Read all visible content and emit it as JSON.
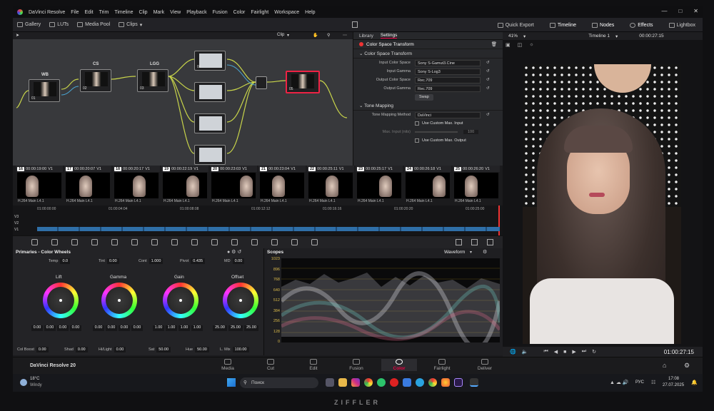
{
  "menubar": {
    "app": "DaVinci Resolve",
    "items": [
      "File",
      "Edit",
      "Trim",
      "Timeline",
      "Clip",
      "Mark",
      "View",
      "Playback",
      "Fusion",
      "Color",
      "Fairlight",
      "Workspace",
      "Help"
    ]
  },
  "toolbar": {
    "gallery": "Gallery",
    "luts": "LUTs",
    "media_pool": "Media Pool",
    "clips": "Clips",
    "quick_export": "Quick Export",
    "timeline": "Timeline",
    "nodes": "Nodes",
    "effects": "Effects",
    "lightbox": "Lightbox"
  },
  "nodebar": {
    "clip": "Clip"
  },
  "nodes": {
    "n1": {
      "label": "WB",
      "num": "01"
    },
    "n2": {
      "label": "CS",
      "num": "02"
    },
    "n3": {
      "label": "LGG",
      "num": "03"
    },
    "n4": {
      "num": "04"
    },
    "n5": {
      "num": "05"
    }
  },
  "panel": {
    "tab_library": "Library",
    "tab_settings": "Settings",
    "title": "Color Space Transform",
    "section1": "Color Space Transform",
    "input_cs_label": "Input Color Space",
    "input_cs": "Sony S-Gamut3.Cine",
    "input_gamma_label": "Input Gamma",
    "input_gamma": "Sony S-Log3",
    "output_cs_label": "Output Color Space",
    "output_cs": "Rec.709",
    "output_gamma_label": "Output Gamma",
    "output_gamma": "Rec.709",
    "swap": "Swap",
    "section2": "Tone Mapping",
    "tm_method_label": "Tone Mapping Method",
    "tm_method": "DaVinci",
    "custom_input": "Use Custom Max. Input",
    "max_input_label": "Max. Input (nits)",
    "max_input": "100",
    "custom_output": "Use Custom Max. Output"
  },
  "viewer": {
    "zoom": "41%",
    "timeline_name": "Timeline 1",
    "timecode_top": "00:00:27:15",
    "timecode": "01:00:27:15"
  },
  "clips": [
    {
      "n": "16",
      "tc": "00:00:19:00",
      "v": "V1",
      "codec": "H.264 Main L4.1"
    },
    {
      "n": "17",
      "tc": "00:00:20:07",
      "v": "V1",
      "codec": "H.264 Main L4.1"
    },
    {
      "n": "18",
      "tc": "00:00:20:17",
      "v": "V1",
      "codec": "H.264 Main L4.1"
    },
    {
      "n": "19",
      "tc": "00:00:22:19",
      "v": "V1",
      "codec": "H.264 Main L4.1"
    },
    {
      "n": "20",
      "tc": "00:00:23:03",
      "v": "V1",
      "codec": "H.264 Main L4.1"
    },
    {
      "n": "21",
      "tc": "00:00:23:04",
      "v": "V1",
      "codec": "H.264 Main L4.1"
    },
    {
      "n": "22",
      "tc": "00:00:25:11",
      "v": "V1",
      "codec": "H.264 Main L4.1"
    },
    {
      "n": "23",
      "tc": "00:00:25:17",
      "v": "V1",
      "codec": "H.264 Main L4.1"
    },
    {
      "n": "24",
      "tc": "00:00:26:18",
      "v": "V1",
      "codec": "H.264 Main L4.1"
    },
    {
      "n": "25",
      "tc": "00:00:26:20",
      "v": "V1",
      "codec": "H.264 Main L4.1"
    }
  ],
  "ruler": [
    "01:00:00:00",
    "01:00:04:04",
    "01:00:08:08",
    "01:00:12:12",
    "01:00:16:16",
    "01:00:20:20",
    "01:00:25:00"
  ],
  "tracks": [
    "V3",
    "V2",
    "V1"
  ],
  "primaries": {
    "title": "Primaries - Color Wheels",
    "temp_label": "Temp",
    "temp": "0.0",
    "tint_label": "Tint",
    "tint": "0.00",
    "cont_label": "Cont",
    "cont": "1.000",
    "pivot_label": "Pivot",
    "pivot": "0.435",
    "md_label": "MD",
    "md": "0.00",
    "lift": "Lift",
    "gamma": "Gamma",
    "gain": "Gain",
    "offset": "Offset",
    "lift_vals": [
      "0.00",
      "0.00",
      "0.00",
      "0.00"
    ],
    "gamma_vals": [
      "0.00",
      "0.00",
      "0.00",
      "0.00"
    ],
    "gain_vals": [
      "1.00",
      "1.00",
      "1.00",
      "1.00"
    ],
    "offset_vals": [
      "25.00",
      "25.00",
      "25.00"
    ],
    "colboost_label": "Col Boost",
    "colboost": "0.00",
    "shad_label": "Shad",
    "shad": "0.00",
    "hilight_label": "Hi/Light",
    "hilight": "0.00",
    "sat_label": "Sat",
    "sat": "50.00",
    "hue_label": "Hue",
    "hue": "50.00",
    "lmix_label": "L. Mix",
    "lmix": "100.00"
  },
  "scopes": {
    "title": "Scopes",
    "mode": "Waveform",
    "scale": [
      "1023",
      "896",
      "768",
      "640",
      "512",
      "384",
      "256",
      "128",
      "0"
    ]
  },
  "pages": {
    "app": "DaVinci Resolve 20",
    "media": "Media",
    "cut": "Cut",
    "edit": "Edit",
    "fusion": "Fusion",
    "color": "Color",
    "fairlight": "Fairlight",
    "deliver": "Deliver"
  },
  "taskbar": {
    "temp": "18°C",
    "weather": "Windy",
    "search": "Поиск",
    "lang": "РУС",
    "time": "17:08",
    "date": "27.07.2025"
  },
  "brand": "ZIFFLER"
}
